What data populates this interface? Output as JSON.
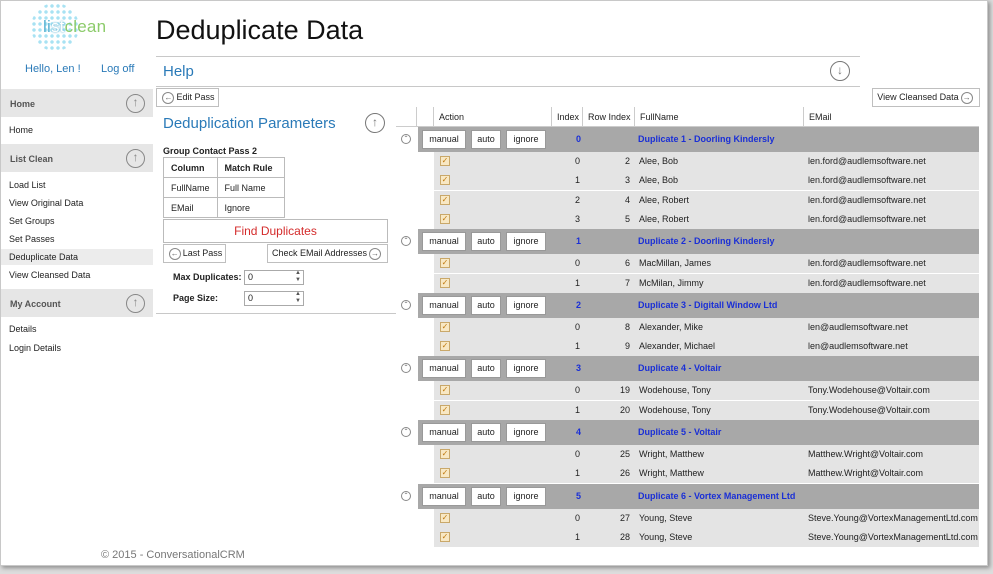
{
  "brand": {
    "logo_prefix": "li",
    "logo_mid": "st",
    "logo_suffix": "clean"
  },
  "user": {
    "greeting": "Hello, Len !",
    "logoff": "Log off"
  },
  "page": {
    "title": "Deduplicate Data",
    "help": "Help",
    "copyright": "© 2015 - ConversationalCRM"
  },
  "sidebar": {
    "sections": [
      {
        "label": "Home",
        "items": [
          "Home"
        ]
      },
      {
        "label": "List Clean",
        "items": [
          "Load List",
          "View Original Data",
          "Set Groups",
          "Set Passes",
          "Deduplicate Data",
          "View Cleansed Data"
        ],
        "active": "Deduplicate Data"
      },
      {
        "label": "My Account",
        "items": [
          "Details",
          "Login Details"
        ]
      }
    ]
  },
  "toolbar": {
    "edit_pass": "Edit Pass",
    "view_cleansed": "View Cleansed Data"
  },
  "params": {
    "title": "Deduplication Parameters",
    "pass_label": "Group Contact Pass 2",
    "columns_header": "Column",
    "rule_header": "Match Rule",
    "rules": [
      {
        "column": "FullName",
        "rule": "Full Name"
      },
      {
        "column": "EMail",
        "rule": "Ignore"
      }
    ],
    "find_duplicates": "Find Duplicates",
    "last_pass": "Last Pass",
    "check_email": "Check EMail Addresses",
    "max_duplicates_label": "Max Duplicates:",
    "max_duplicates_value": "0",
    "page_size_label": "Page Size:",
    "page_size_value": "0"
  },
  "grid": {
    "headers": [
      "Action",
      "Index",
      "Row Index",
      "FullName",
      "EMail"
    ],
    "action_buttons": [
      "manual",
      "auto",
      "ignore"
    ],
    "groups": [
      {
        "index": "0",
        "name": "Duplicate 1 - Doorling Kindersly",
        "rows": [
          {
            "index": "0",
            "row_index": "2",
            "fullname": "Alee, Bob",
            "email": "len.ford@audlemsoftware.net"
          },
          {
            "index": "1",
            "row_index": "3",
            "fullname": "Alee, Bob",
            "email": "len.ford@audlemsoftware.net"
          },
          {
            "index": "2",
            "row_index": "4",
            "fullname": "Alee, Robert",
            "email": "len.ford@audlemsoftware.net"
          },
          {
            "index": "3",
            "row_index": "5",
            "fullname": "Alee, Robert",
            "email": "len.ford@audlemsoftware.net"
          }
        ]
      },
      {
        "index": "1",
        "name": "Duplicate 2 - Doorling Kindersly",
        "rows": [
          {
            "index": "0",
            "row_index": "6",
            "fullname": "MacMillan, James",
            "email": "len.ford@audlemsoftware.net"
          },
          {
            "index": "1",
            "row_index": "7",
            "fullname": "McMilan, Jimmy",
            "email": "len.ford@audlemsoftware.net"
          }
        ]
      },
      {
        "index": "2",
        "name": "Duplicate 3 - Digitall Window Ltd",
        "rows": [
          {
            "index": "0",
            "row_index": "8",
            "fullname": "Alexander, Mike",
            "email": "len@audlemsoftware.net"
          },
          {
            "index": "1",
            "row_index": "9",
            "fullname": "Alexander, Michael",
            "email": "len@audlemsoftware.net"
          }
        ]
      },
      {
        "index": "3",
        "name": "Duplicate 4 - Voltair",
        "rows": [
          {
            "index": "0",
            "row_index": "19",
            "fullname": "Wodehouse, Tony",
            "email": "Tony.Wodehouse@Voltair.com"
          },
          {
            "index": "1",
            "row_index": "20",
            "fullname": "Wodehouse, Tony",
            "email": "Tony.Wodehouse@Voltair.com"
          }
        ]
      },
      {
        "index": "4",
        "name": "Duplicate 5 - Voltair",
        "rows": [
          {
            "index": "0",
            "row_index": "25",
            "fullname": "Wright, Matthew",
            "email": "Matthew.Wright@Voltair.com"
          },
          {
            "index": "1",
            "row_index": "26",
            "fullname": "Wright, Matthew",
            "email": "Matthew.Wright@Voltair.com"
          }
        ]
      },
      {
        "index": "5",
        "name": "Duplicate 6 - Vortex Management Ltd",
        "rows": [
          {
            "index": "0",
            "row_index": "27",
            "fullname": "Young, Steve",
            "email": "Steve.Young@VortexManagementLtd.com"
          },
          {
            "index": "1",
            "row_index": "28",
            "fullname": "Young, Steve",
            "email": "Steve.Young@VortexManagementLtd.com"
          }
        ]
      }
    ]
  },
  "colors": {
    "link": "#2a7ab8",
    "group_band": "#a8a8a8",
    "group_text": "#1a2fd6",
    "find_text": "#d42b2b"
  }
}
